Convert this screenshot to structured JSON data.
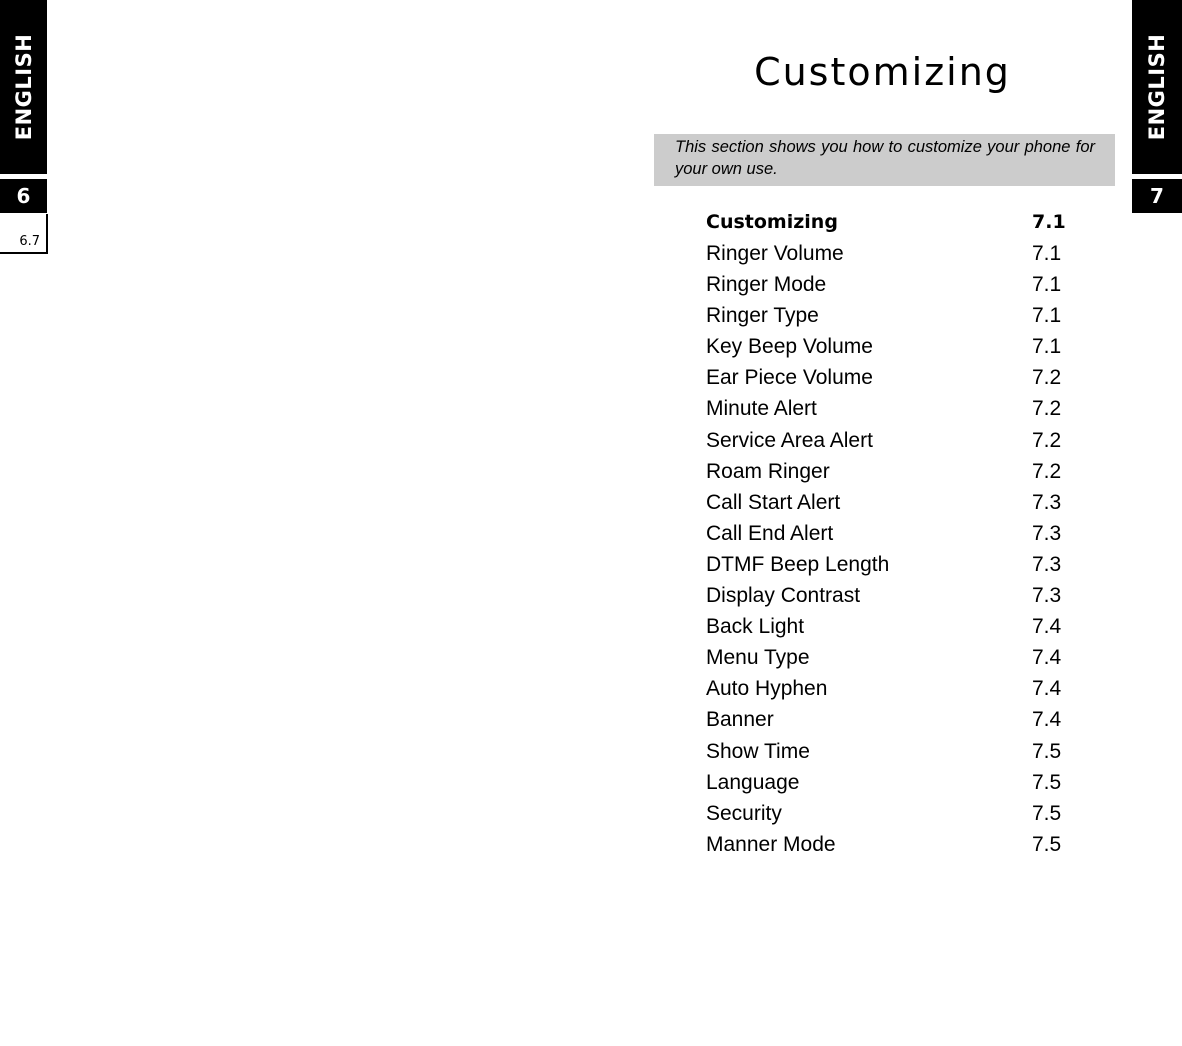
{
  "left_page": {
    "side_tab": "ENGLISH",
    "chapter_number": "6",
    "page_number": "6.7"
  },
  "right_page": {
    "side_tab": "ENGLISH",
    "chapter_number": "7",
    "title": "Customizing",
    "intro": "This section shows you how to customize your phone for your own use.",
    "toc": {
      "heading": {
        "label": "Customizing",
        "page": "7.1"
      },
      "items": [
        {
          "label": "Ringer Volume",
          "page": "7.1"
        },
        {
          "label": "Ringer Mode",
          "page": "7.1"
        },
        {
          "label": "Ringer Type",
          "page": "7.1"
        },
        {
          "label": "Key Beep Volume",
          "page": "7.1"
        },
        {
          "label": "Ear Piece Volume",
          "page": "7.2"
        },
        {
          "label": "Minute Alert",
          "page": "7.2"
        },
        {
          "label": "Service Area Alert",
          "page": "7.2"
        },
        {
          "label": "Roam Ringer",
          "page": "7.2"
        },
        {
          "label": "Call Start Alert",
          "page": "7.3"
        },
        {
          "label": "Call End Alert",
          "page": "7.3"
        },
        {
          "label": "DTMF Beep Length",
          "page": "7.3"
        },
        {
          "label": "Display Contrast",
          "page": "7.3"
        },
        {
          "label": "Back Light",
          "page": "7.4"
        },
        {
          "label": "Menu Type",
          "page": "7.4"
        },
        {
          "label": "Auto Hyphen",
          "page": "7.4"
        },
        {
          "label": "Banner",
          "page": "7.4"
        },
        {
          "label": "Show Time",
          "page": "7.5"
        },
        {
          "label": "Language",
          "page": "7.5"
        },
        {
          "label": "Security",
          "page": "7.5"
        },
        {
          "label": "Manner Mode",
          "page": "7.5"
        }
      ]
    }
  }
}
